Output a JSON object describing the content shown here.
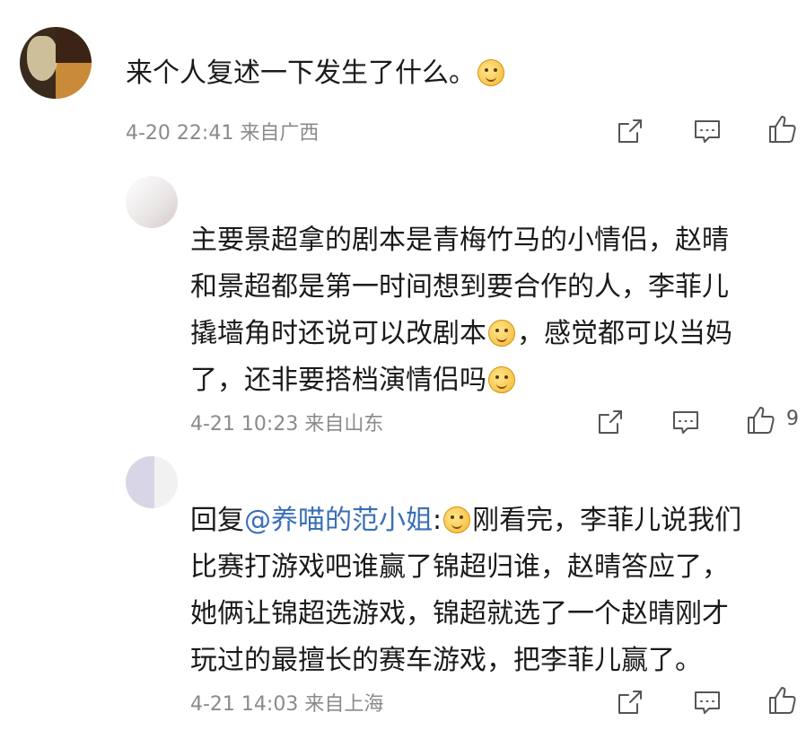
{
  "main_comment": {
    "username": "",
    "text": "来个人复述一下发生了什么。",
    "emoji": "doge-emoji",
    "time": "4-20 22:41",
    "location": "来自广西"
  },
  "replies": [
    {
      "username": "",
      "text_lines": [
        "主要景超拿的剧本是青梅竹马的小情侣，赵晴",
        "和景超都是第一时间想到要合作的人，李菲儿",
        "撬墙角时还说可以改剧本",
        "，感觉都可以当妈",
        "了，还非要搭档演情侣吗"
      ],
      "time": "4-21 10:23",
      "location": "来自山东",
      "like_count": "9"
    },
    {
      "username": "",
      "reply_prefix": "回复",
      "mention": "@养喵的范小姐",
      "colon": ":",
      "text_lines": [
        "刚看完，李菲儿说我们",
        "比赛打游戏吧谁赢了锦超归谁，赵晴答应了，",
        "她俩让锦超选游戏，锦超就选了一个赵晴刚才",
        "玩过的最擅长的赛车游戏，把李菲儿赢了。"
      ],
      "time": "4-21 14:03",
      "location": "来自上海"
    }
  ],
  "more_replies": "",
  "icons": {
    "share": "share-icon",
    "comment": "comment-icon",
    "like": "like-icon"
  },
  "colors": {
    "mention": "#3a6fb7",
    "meta": "#8a8a8a"
  }
}
